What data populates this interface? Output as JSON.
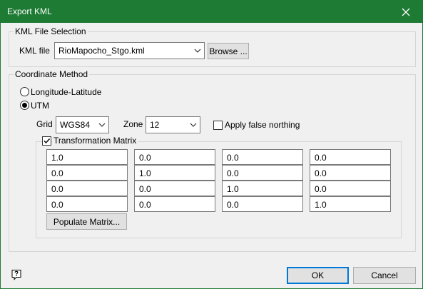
{
  "window": {
    "title": "Export KML"
  },
  "kml_file_selection": {
    "legend": "KML File Selection",
    "label": "KML file",
    "value": "RioMapocho_Stgo.kml",
    "browse_label": "Browse ..."
  },
  "coordinate_method": {
    "legend": "Coordinate Method",
    "options": [
      {
        "label": "Longitude-Latitude",
        "selected": false
      },
      {
        "label": "UTM",
        "selected": true
      }
    ],
    "grid_label": "Grid",
    "grid_value": "WGS84",
    "zone_label": "Zone",
    "zone_value": "12",
    "false_northing_label": "Apply false northing",
    "false_northing_checked": false
  },
  "transformation_matrix": {
    "label": "Transformation Matrix",
    "checked": true,
    "rows": [
      [
        "1.0",
        "0.0",
        "0.0",
        "0.0"
      ],
      [
        "0.0",
        "1.0",
        "0.0",
        "0.0"
      ],
      [
        "0.0",
        "0.0",
        "1.0",
        "0.0"
      ],
      [
        "0.0",
        "0.0",
        "0.0",
        "1.0"
      ]
    ],
    "populate_label": "Populate Matrix..."
  },
  "footer": {
    "ok_label": "OK",
    "cancel_label": "Cancel"
  },
  "icons": {
    "close": "close-icon",
    "help": "help-icon",
    "dropdown": "chevron-down-icon"
  }
}
